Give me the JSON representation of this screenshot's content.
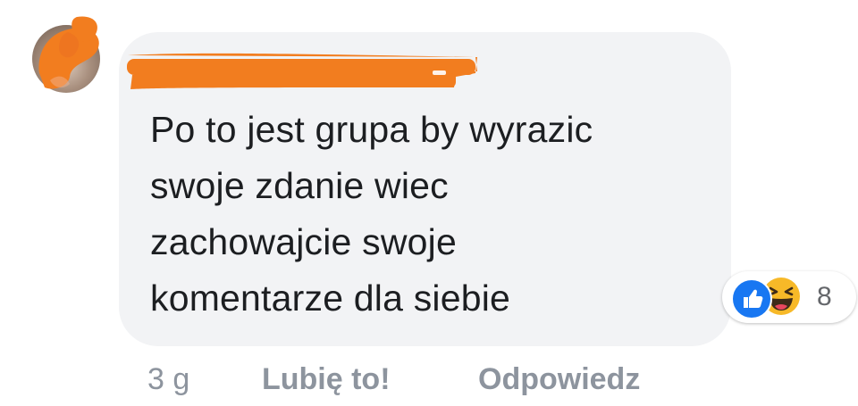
{
  "comment": {
    "author_name_redacted": true,
    "text_lines": [
      "Po to jest grupa by wyrazic",
      "swoje zdanie wiec",
      "zachowajcie swoje",
      "komentarze dla siebie"
    ]
  },
  "reactions": {
    "types": [
      "like-icon",
      "haha-icon"
    ],
    "count": "8",
    "colors": {
      "like": "#1877f2",
      "haha": "#f7b928"
    }
  },
  "actions": {
    "timestamp": "3 g",
    "like_label": "Lubię to!",
    "reply_label": "Odpowiedz"
  },
  "colors": {
    "bubble": "#f2f3f5",
    "text": "#1c1e21",
    "meta": "#8d949e",
    "redaction": "#f27d1f"
  }
}
